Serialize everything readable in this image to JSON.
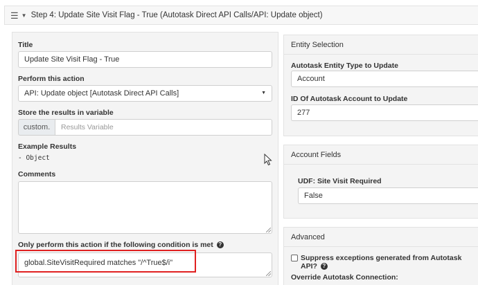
{
  "step": {
    "menu_icon": "hamburger-icon",
    "caret_icon": "caret-down-icon",
    "title": "Step 4: Update Site Visit Flag - True (Autotask Direct API Calls/API: Update object)"
  },
  "left": {
    "title_label": "Title",
    "title_value": "Update Site Visit Flag - True",
    "action_label": "Perform this action",
    "action_value": "API: Update object [Autotask Direct API Calls]",
    "store_label": "Store the results in variable",
    "store_prefix": "custom.",
    "store_placeholder": "Results Variable",
    "example_label": "Example Results",
    "example_value": "- Object",
    "comments_label": "Comments",
    "comments_value": "",
    "condition_label": "Only perform this action if the following condition is met",
    "condition_value": "global.SiteVisitRequired matches \"/^True$/i\""
  },
  "entity": {
    "heading": "Entity Selection",
    "type_label": "Autotask Entity Type to Update",
    "type_value": "Account",
    "id_label": "ID Of Autotask Account to Update",
    "id_value": "277"
  },
  "fields": {
    "heading": "Account Fields",
    "udf_label": "UDF: Site Visit Required",
    "udf_value": "False"
  },
  "advanced": {
    "heading": "Advanced",
    "suppress_label": "Suppress exceptions generated from Autotask API?",
    "override_label": "Override Autotask Connection:"
  },
  "colors": {
    "highlight": "#e02020",
    "panel_bg": "#f4f4f4"
  }
}
